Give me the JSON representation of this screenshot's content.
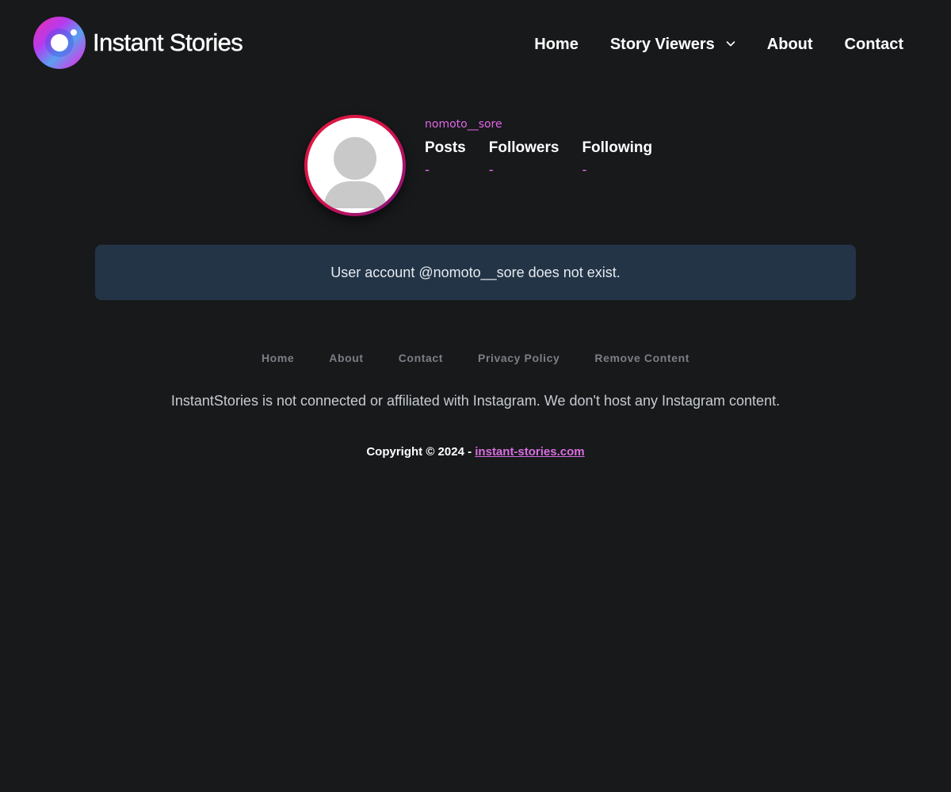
{
  "header": {
    "logo_text": "Instant Stories",
    "logo_icon": "camera-lens-logo-icon",
    "nav": [
      {
        "label": "Home"
      },
      {
        "label": "Story Viewers",
        "has_dropdown": true
      },
      {
        "label": "About"
      },
      {
        "label": "Contact"
      }
    ]
  },
  "profile": {
    "username": "nomoto__sore",
    "avatar_icon": "default-user-avatar-icon",
    "stats": [
      {
        "label": "Posts",
        "value": "-"
      },
      {
        "label": "Followers",
        "value": "-"
      },
      {
        "label": "Following",
        "value": "-"
      }
    ]
  },
  "alert": {
    "message": "User account @nomoto__sore does not exist."
  },
  "footer": {
    "links": [
      {
        "label": "Home"
      },
      {
        "label": "About"
      },
      {
        "label": "Contact"
      },
      {
        "label": "Privacy Policy"
      },
      {
        "label": "Remove Content"
      }
    ],
    "disclaimer": "InstantStories is not connected or affiliated with Instagram. We don't host any Instagram content.",
    "copyright_prefix": "Copyright © 2024 - ",
    "copyright_link": "instant-stories.com"
  },
  "colors": {
    "background": "#17191b",
    "accent": "#e066e6",
    "alert_background": "#233446",
    "avatar_ring_start": "#e01a3f",
    "avatar_ring_end": "#7a1488"
  }
}
